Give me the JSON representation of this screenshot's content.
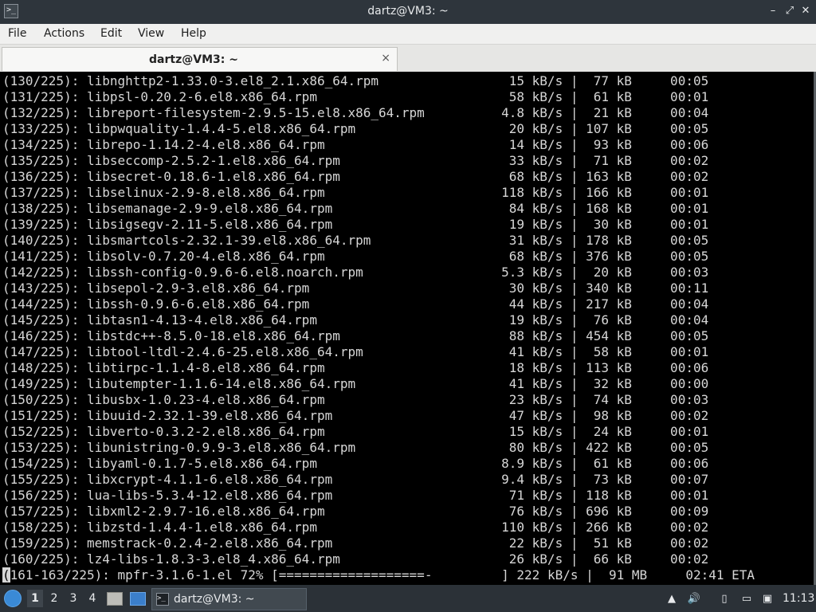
{
  "window": {
    "title": "dartz@VM3: ~",
    "app_icon_glyph": ">_",
    "minimize_glyph": "–",
    "maximize_glyph": "⤢",
    "close_glyph": "✕"
  },
  "menu": {
    "items": [
      "File",
      "Actions",
      "Edit",
      "View",
      "Help"
    ]
  },
  "tab": {
    "label": "dartz@VM3: ~",
    "close_glyph": "×"
  },
  "terminal": {
    "lines": [
      "(130/225): libnghttp2-1.33.0-3.el8_2.1.x86_64.rpm                 15 kB/s |  77 kB     00:05",
      "(131/225): libpsl-0.20.2-6.el8.x86_64.rpm                         58 kB/s |  61 kB     00:01",
      "(132/225): libreport-filesystem-2.9.5-15.el8.x86_64.rpm          4.8 kB/s |  21 kB     00:04",
      "(133/225): libpwquality-1.4.4-5.el8.x86_64.rpm                    20 kB/s | 107 kB     00:05",
      "(134/225): librepo-1.14.2-4.el8.x86_64.rpm                        14 kB/s |  93 kB     00:06",
      "(135/225): libseccomp-2.5.2-1.el8.x86_64.rpm                      33 kB/s |  71 kB     00:02",
      "(136/225): libsecret-0.18.6-1.el8.x86_64.rpm                      68 kB/s | 163 kB     00:02",
      "(137/225): libselinux-2.9-8.el8.x86_64.rpm                       118 kB/s | 166 kB     00:01",
      "(138/225): libsemanage-2.9-9.el8.x86_64.rpm                       84 kB/s | 168 kB     00:01",
      "(139/225): libsigsegv-2.11-5.el8.x86_64.rpm                       19 kB/s |  30 kB     00:01",
      "(140/225): libsmartcols-2.32.1-39.el8.x86_64.rpm                  31 kB/s | 178 kB     00:05",
      "(141/225): libsolv-0.7.20-4.el8.x86_64.rpm                        68 kB/s | 376 kB     00:05",
      "(142/225): libssh-config-0.9.6-6.el8.noarch.rpm                  5.3 kB/s |  20 kB     00:03",
      "(143/225): libsepol-2.9-3.el8.x86_64.rpm                          30 kB/s | 340 kB     00:11",
      "(144/225): libssh-0.9.6-6.el8.x86_64.rpm                          44 kB/s | 217 kB     00:04",
      "(145/225): libtasn1-4.13-4.el8.x86_64.rpm                         19 kB/s |  76 kB     00:04",
      "(146/225): libstdc++-8.5.0-18.el8.x86_64.rpm                      88 kB/s | 454 kB     00:05",
      "(147/225): libtool-ltdl-2.4.6-25.el8.x86_64.rpm                   41 kB/s |  58 kB     00:01",
      "(148/225): libtirpc-1.1.4-8.el8.x86_64.rpm                        18 kB/s | 113 kB     00:06",
      "(149/225): libutempter-1.1.6-14.el8.x86_64.rpm                    41 kB/s |  32 kB     00:00",
      "(150/225): libusbx-1.0.23-4.el8.x86_64.rpm                        23 kB/s |  74 kB     00:03",
      "(151/225): libuuid-2.32.1-39.el8.x86_64.rpm                       47 kB/s |  98 kB     00:02",
      "(152/225): libverto-0.3.2-2.el8.x86_64.rpm                        15 kB/s |  24 kB     00:01",
      "(153/225): libunistring-0.9.9-3.el8.x86_64.rpm                    80 kB/s | 422 kB     00:05",
      "(154/225): libyaml-0.1.7-5.el8.x86_64.rpm                        8.9 kB/s |  61 kB     00:06",
      "(155/225): libxcrypt-4.1.1-6.el8.x86_64.rpm                      9.4 kB/s |  73 kB     00:07",
      "(156/225): lua-libs-5.3.4-12.el8.x86_64.rpm                       71 kB/s | 118 kB     00:01",
      "(157/225): libxml2-2.9.7-16.el8.x86_64.rpm                        76 kB/s | 696 kB     00:09",
      "(158/225): libzstd-1.4.4-1.el8.x86_64.rpm                        110 kB/s | 266 kB     00:02",
      "(159/225): memstrack-0.2.4-2.el8.x86_64.rpm                       22 kB/s |  51 kB     00:02",
      "(160/225): lz4-libs-1.8.3-3.el8_4.x86_64.rpm                      26 kB/s |  66 kB     00:02"
    ],
    "progress_cursor_char": "(",
    "progress_rest": "161-163/225): mpfr-3.1.6-1.el 72% [===================-         ] 222 kB/s |  91 MB     02:41 ETA"
  },
  "taskbar": {
    "workspaces": [
      "1",
      "2",
      "3",
      "4"
    ],
    "active_workspace": "1",
    "task_label": "dartz@VM3: ~",
    "task_icon_glyph": ">_",
    "tray_glyphs": {
      "up": "▲",
      "volume": "🔊",
      "clipboard": "▯",
      "network": "▭",
      "notes": "▣"
    },
    "clock": "11:13"
  }
}
